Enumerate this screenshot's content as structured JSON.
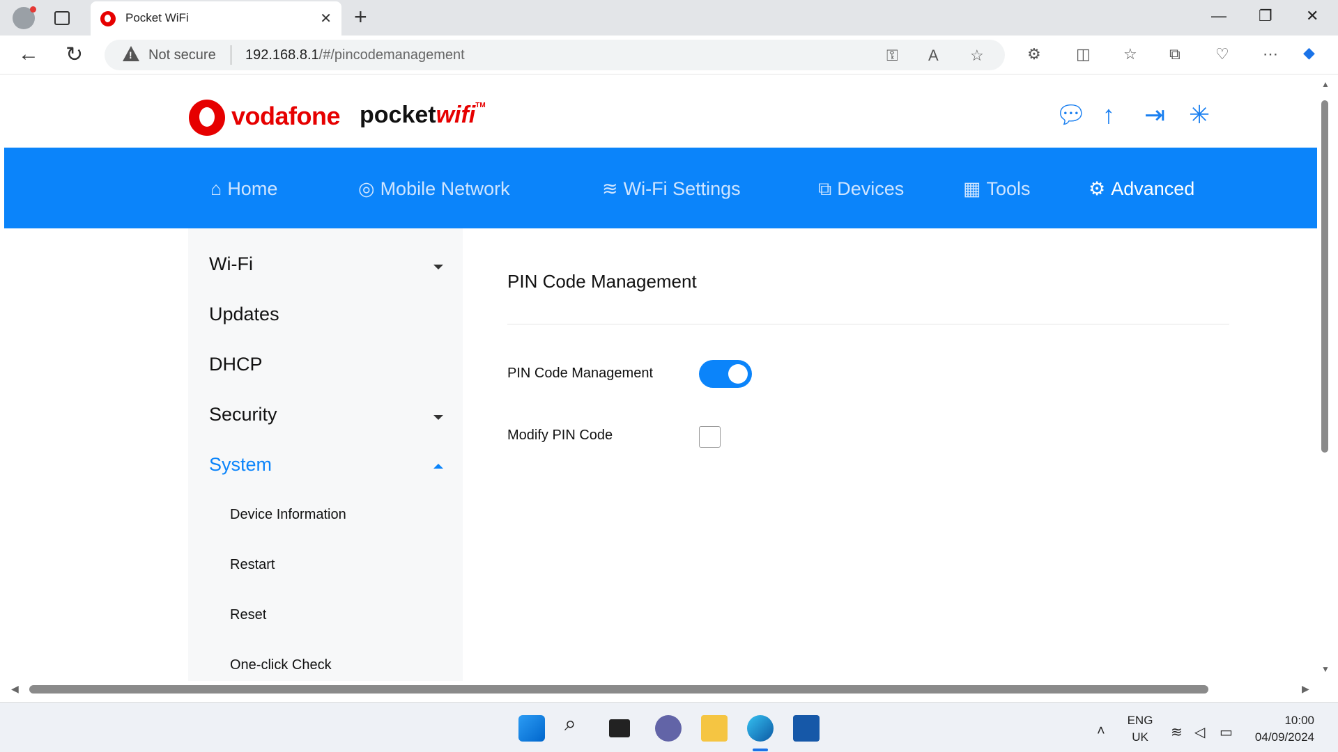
{
  "browser": {
    "tab_title": "Pocket WiFi",
    "address_security": "Not secure",
    "url_host": "192.168.8.1",
    "url_path": "/#/pincodemanagement"
  },
  "brand": {
    "company": "vodafone",
    "product_main": "pocket",
    "product_accent": "wifi",
    "product_mark": "TM"
  },
  "main_nav": [
    {
      "label": "Home",
      "icon": "home-icon"
    },
    {
      "label": "Mobile Network",
      "icon": "globe-icon"
    },
    {
      "label": "Wi-Fi Settings",
      "icon": "wifi-icon"
    },
    {
      "label": "Devices",
      "icon": "devices-icon"
    },
    {
      "label": "Tools",
      "icon": "tools-icon"
    },
    {
      "label": "Advanced",
      "icon": "gear-icon",
      "active": true
    }
  ],
  "sidebar": {
    "items": [
      {
        "label": "Wi-Fi",
        "expandable": true
      },
      {
        "label": "Updates"
      },
      {
        "label": "DHCP"
      },
      {
        "label": "Security",
        "expandable": true
      },
      {
        "label": "System",
        "expanded": true,
        "active": true
      }
    ],
    "system_children": [
      {
        "label": "Device Information"
      },
      {
        "label": "Restart"
      },
      {
        "label": "Reset"
      },
      {
        "label": "One-click Check"
      }
    ]
  },
  "content": {
    "title": "PIN Code Management",
    "pin_management_label": "PIN Code Management",
    "pin_management_enabled": true,
    "modify_pin_label": "Modify PIN Code",
    "modify_pin_checked": false
  },
  "taskbar": {
    "lang_top": "ENG",
    "lang_bottom": "UK",
    "time": "10:00",
    "date": "04/09/2024"
  },
  "colors": {
    "accent": "#0b84fa",
    "brand_red": "#e60000"
  }
}
